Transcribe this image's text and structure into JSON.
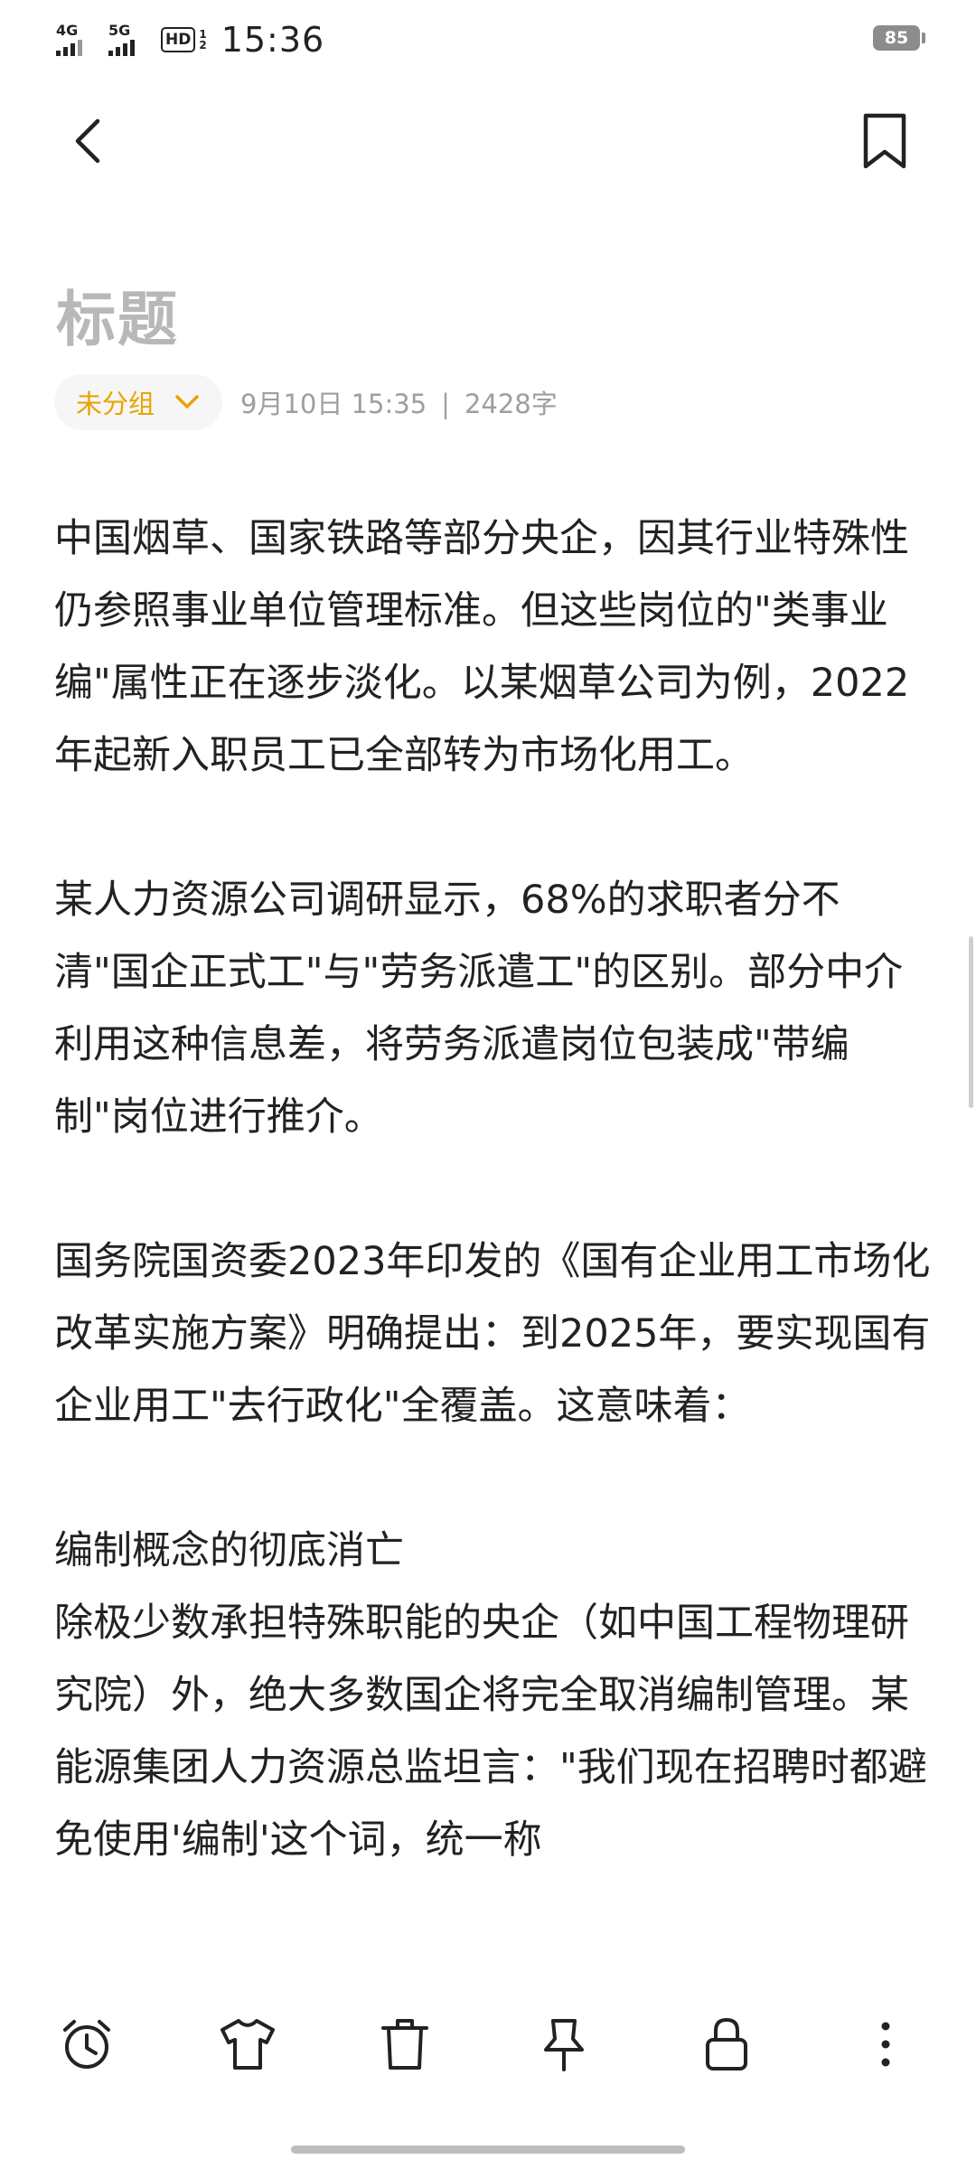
{
  "status_bar": {
    "net1": "4G",
    "net2": "5G",
    "hd": "HD",
    "hd_sub": "1\n2",
    "time": "15:36",
    "battery": "85"
  },
  "header": {
    "back_icon": "chevron-left-icon",
    "bookmark_icon": "bookmark-icon"
  },
  "note": {
    "title": "标题",
    "group_label": "未分组",
    "date": "9月10日 15:35",
    "separator": "|",
    "word_count": "2428字",
    "paragraphs": [
      "中国烟草、国家铁路等部分央企，因其行业特殊性仍参照事业单位管理标准。但这些岗位的\"类事业编\"属性正在逐步淡化。以某烟草公司为例，2022年起新入职员工已全部转为市场化用工。",
      "某人力资源公司调研显示，68%的求职者分不清\"国企正式工\"与\"劳务派遣工\"的区别。部分中介利用这种信息差，将劳务派遣岗位包装成\"带编制\"岗位进行推介。",
      "国务院国资委2023年印发的《国有企业用工市场化改革实施方案》明确提出：到2025年，要实现国有企业用工\"去行政化\"全覆盖。这意味着：",
      "编制概念的彻底消亡",
      "除极少数承担特殊职能的央企（如中国工程物理研究院）外，绝大多数国企将完全取消编制管理。某能源集团人力资源总监坦言：\"我们现在招聘时都避免使用'编制'这个词，统一称"
    ]
  },
  "toolbar": {
    "icons": [
      "alarm-clock-icon",
      "shirt-icon",
      "trash-icon",
      "pin-icon",
      "lock-icon",
      "more-vertical-icon"
    ]
  },
  "colors": {
    "accent": "#e8a400",
    "title_placeholder": "#b8b8b8",
    "meta_text": "#9e9e9e",
    "body_text": "#222222"
  }
}
